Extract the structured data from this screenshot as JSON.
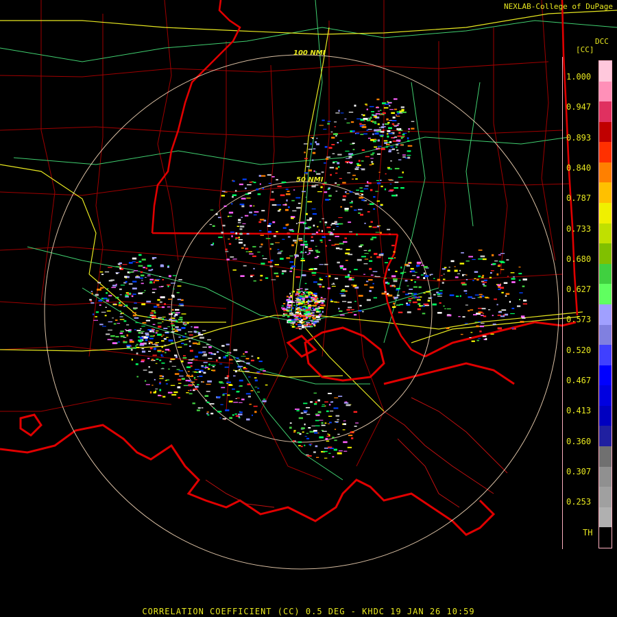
{
  "header": {
    "credit": "NEXLAB-College of DuPage"
  },
  "legend": {
    "product_code": "DCC",
    "unit": "[CC]",
    "ticks": [
      "1.000",
      "0.947",
      "0.893",
      "0.840",
      "0.787",
      "0.733",
      "0.680",
      "0.627",
      "0.573",
      "0.520",
      "0.467",
      "0.413",
      "0.360",
      "0.307",
      "0.253",
      "TH"
    ],
    "colors": [
      "#ffc8dc",
      "#ff90b8",
      "#e03060",
      "#c00000",
      "#ff3000",
      "#ff8000",
      "#ffc000",
      "#f0f000",
      "#c0e000",
      "#80c000",
      "#40d040",
      "#60ff60",
      "#a0a0ff",
      "#8080e0",
      "#4040ff",
      "#0000ff",
      "#0000e0",
      "#0000c0",
      "#2020a0",
      "#707070",
      "#909090",
      "#a0a0a0",
      "#b0b0b0",
      "#000000"
    ]
  },
  "map": {
    "range_rings": [
      "50 NMI",
      "100 NMI"
    ],
    "colors": {
      "state_lines": "#e00000",
      "county_lines": "#a00000",
      "highways": "#e8e820",
      "rivers": "#40d070",
      "rings": "#ffe0c0"
    }
  },
  "footer": {
    "caption": "CORRELATION COEFFICIENT (CC) 0.5 DEG - KHDC 19 JAN 26 10:59"
  }
}
